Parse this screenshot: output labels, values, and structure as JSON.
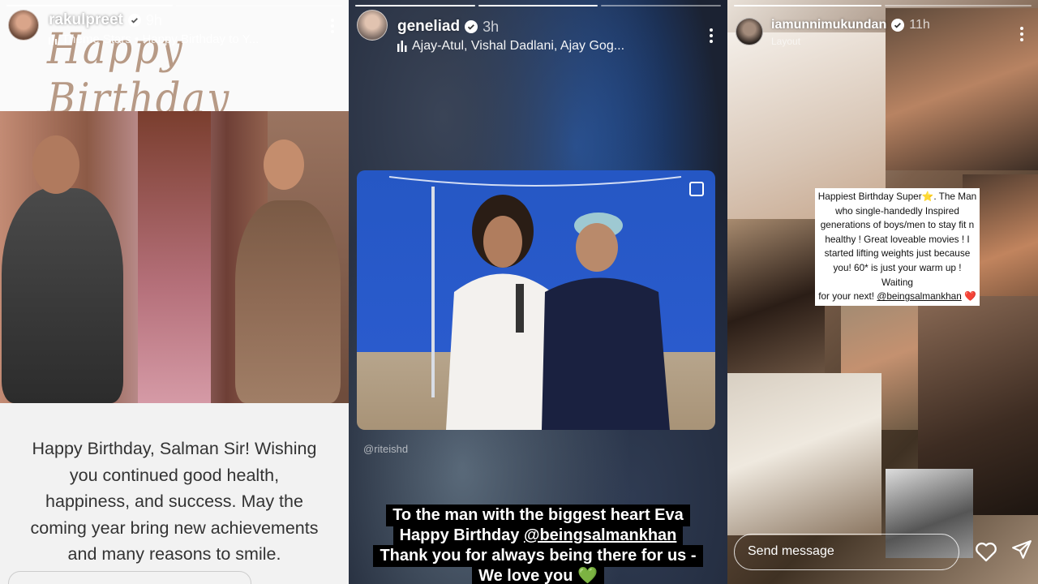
{
  "stories": [
    {
      "username": "rakulpreet",
      "time": "9h",
      "music": "Theme Stars • Happy Birthday to Y...",
      "banner_text": "Happy Birthday",
      "caption_lines": [
        "Happy Birthday, Salman Sir! Wishing",
        "you continued good health,",
        "happiness, and success. May the",
        "coming year bring new achievements",
        "and many reasons to smile."
      ]
    },
    {
      "username": "geneliad",
      "time": "3h",
      "music": "Ajay-Atul, Vishal Dadlani, Ajay Gog...",
      "mention": "@riteishd",
      "text_lines": [
        {
          "pre": "To the man with the biggest heart Eva",
          "tag": "",
          "post": ""
        },
        {
          "pre": "Happy Birthday ",
          "tag": "@beingsalmankhan",
          "post": ""
        },
        {
          "pre": "Thank you for always being there for us -",
          "tag": "",
          "post": ""
        },
        {
          "pre": "We love you ",
          "tag": "",
          "post": "💚"
        }
      ]
    },
    {
      "username": "iamunnimukundan",
      "time": "11h",
      "music": "Layout",
      "sticker_lines": [
        "Happiest Birthday Super⭐. The Man",
        "who single-handedly  Inspired",
        "generations of boys/men to  stay fit n",
        "healthy ! Great loveable movies ! I",
        "started lifting weights just because",
        "you! 60* is just your warm up ! Waiting",
        "for your next! "
      ],
      "sticker_tag": "@beingsalmankhan",
      "sticker_end": "❤️",
      "send_placeholder": "Send message"
    }
  ],
  "colors": {
    "verified": "#3897f0",
    "banner_script": "#b79a86",
    "green_heart": "#2ecc40"
  },
  "icons": [
    "verified-badge-icon",
    "music-bars-icon",
    "more-options-icon",
    "multi-photo-icon",
    "heart-icon",
    "share-icon"
  ]
}
